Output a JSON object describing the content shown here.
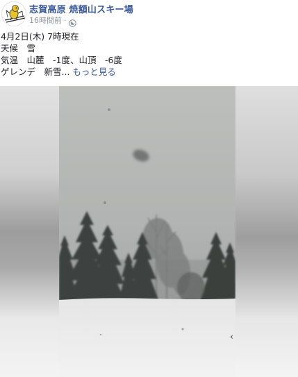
{
  "post": {
    "page_name": "志賀高原 焼額山スキー場",
    "timestamp": "16時間前",
    "audience_icon": "globe-icon",
    "lines": [
      "4月2日(木) 7時現在",
      "天候　雪",
      "気温　山麓　-1度、山頂　-6度"
    ],
    "last_line_prefix": "ゲレンデ　新雪...",
    "see_more": "もっと見る"
  },
  "video": {
    "content": "snowy-forest-video",
    "scroll_hint": "‹"
  },
  "colors": {
    "link": "#385898",
    "text": "#1c1e21",
    "meta": "#90949c"
  }
}
